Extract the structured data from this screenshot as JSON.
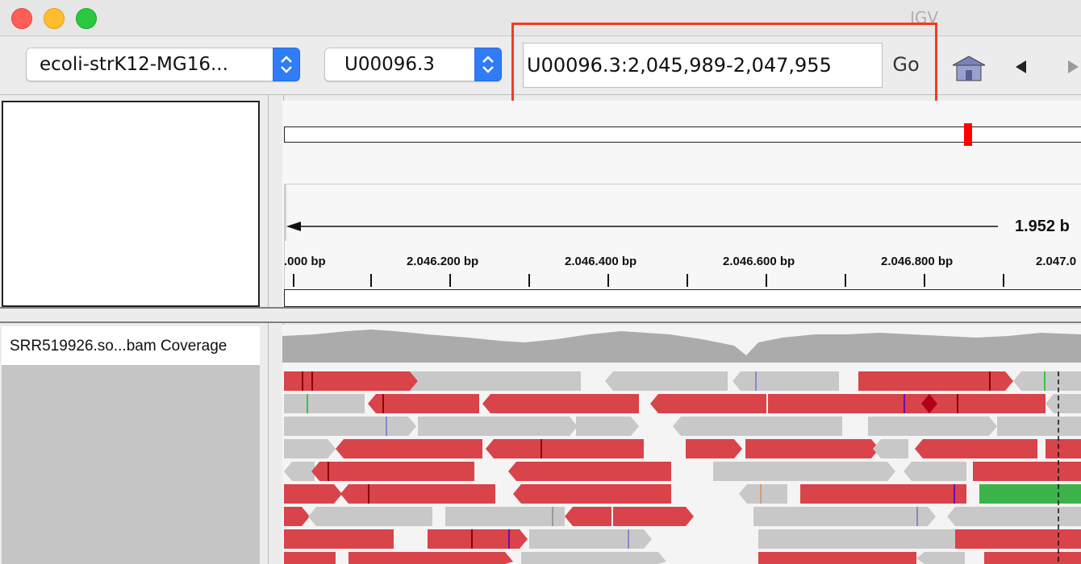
{
  "window": {
    "title": "IGV"
  },
  "toolbar": {
    "genome": "ecoli-strK12-MG16...",
    "chromosome": "U00096.3",
    "locus": "U00096.3:2,045,989-2,047,955",
    "go_label": "Go"
  },
  "ruler": {
    "span_label": "1.952 b",
    "ticks": [
      ".000 bp",
      "2.046.200 bp",
      "2.046.400 bp",
      "2.046.600 bp",
      "2.046.800 bp",
      "2.047.0"
    ]
  },
  "tracks": {
    "coverage_name": "SRR519926.so...bam Coverage"
  },
  "colors": {
    "highlight": "#f03d22",
    "read_forward": "#d9434a",
    "read_plain": "#c8c8c8",
    "read_green": "#3bb34a",
    "coverage": "#ababab"
  }
}
